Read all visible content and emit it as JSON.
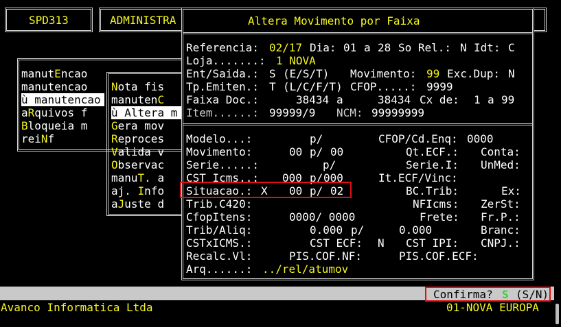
{
  "header": {
    "program": "SPD313",
    "module": "ADMINISTRA",
    "dialog_title": "Altera Movimento por Faixa"
  },
  "menu1": [
    {
      "prefix": "",
      "pre": "manut",
      "hot": "E",
      "post": "ncao"
    },
    {
      "prefix": "",
      "pre": "",
      "hot": "",
      "post": "manutencao"
    },
    {
      "prefix": "ù ",
      "pre": "",
      "hot": "",
      "post": "manutencao"
    },
    {
      "prefix": "",
      "pre": "a",
      "hot": "R",
      "post": "quivos f"
    },
    {
      "prefix": "",
      "pre": "",
      "hot": "B",
      "post": "loqueia m"
    },
    {
      "prefix": "",
      "pre": "rei",
      "hot": "N",
      "post": "f"
    }
  ],
  "menu2": [
    {
      "prefix": "",
      "pre": "",
      "hot": "N",
      "post": "ota fis"
    },
    {
      "prefix": "",
      "pre": "manuten",
      "hot": "C",
      "post": ""
    },
    {
      "prefix": "ù ",
      "pre": "",
      "hot": "A",
      "post": "ltera m"
    },
    {
      "prefix": "",
      "pre": "",
      "hot": "G",
      "post": "era mov"
    },
    {
      "prefix": "",
      "pre": "",
      "hot": "R",
      "post": "eproces"
    },
    {
      "prefix": "",
      "pre": "",
      "hot": "V",
      "post": "alida v"
    },
    {
      "prefix": "",
      "pre": "",
      "hot": "O",
      "post": "bservac"
    },
    {
      "prefix": "",
      "pre": "manu",
      "hot": "T",
      "post": ". a"
    },
    {
      "prefix": "",
      "pre": "aj. ",
      "hot": "I",
      "post": "nfo"
    },
    {
      "prefix": "",
      "pre": "a",
      "hot": "J",
      "post": "uste d"
    }
  ],
  "form_top": {
    "referencia_label": "Referencia:",
    "referencia_value": "02/17",
    "dia_label": "Dia:",
    "dia_from": "01",
    "a1": "a",
    "dia_to": "28",
    "sorel_label": "So Rel.:",
    "sorel_value": "N",
    "idt_label": "Idt:",
    "idt_value": "C",
    "loja_label": "Loja.......:",
    "loja_value": "1 NOVA",
    "entsaida_label": "Ent/Saida.:",
    "entsaida_value": "S",
    "entsaida_hint": "(E/S/T)",
    "movimento_label": "Movimento:",
    "movimento_value": "99",
    "excdup_label": "Exc.Dup:",
    "excdup_value": "N",
    "tpemiten_label": "Tp.Emiten.:",
    "tpemiten_value": "T",
    "tpemiten_hint": "(L/C/F/T)",
    "cfop_label": "CFOP.....:",
    "cfop_value": "9999",
    "faixadoc_label": "Faixa Doc.:",
    "faixadoc_from": "38434",
    "a2": "a",
    "faixadoc_to": "38434",
    "cxde_label": "Cx de:",
    "cx_from": "1",
    "a3": "a",
    "cx_to": "99",
    "item_label": "Item......:",
    "item_value": "99999/9",
    "ncm_label": "NCM:",
    "ncm_value": "99999999"
  },
  "form_bottom": {
    "modelo_label": "Modelo...:",
    "modelo_sep": "p/",
    "cfopcdenq_label": "CFOP/Cd.Enq:",
    "cfopcdenq_value": "0000",
    "movimento_label": "Movimento:",
    "movimento_from": "00",
    "movimento_sep": "p/",
    "movimento_to": "00",
    "qtecf_label": "Qt.ECF.:",
    "conta_label": "Conta:",
    "serie_label": "Serie.....:",
    "serie_sep": "p/",
    "seriei_label": "Serie.I:",
    "unmed_label": "UnMed:",
    "csticms_label": "CST Icms..:",
    "csticms_from": "000",
    "csticms_sep": "p/",
    "csticms_to": "000",
    "itecfvinc_label": "It.ECF/Vinc:",
    "situacao_label": "Situacao.:",
    "situacao_flag": "X",
    "situacao_from": "00",
    "situacao_sep": "p/",
    "situacao_to": "02",
    "bctrib_label": "BC.Trib:",
    "ex_label": "Ex:",
    "tribc420_label": "Trib.C420:",
    "nficms_label": "NFIcms:",
    "zerst_label": "ZerSt:",
    "cfopitens_label": "CfopItens:",
    "cfopitens_value": "0000/ 0000",
    "frete_label": "Frete:",
    "frp_label": "Fr.P.:",
    "tribaliq_label": "Trib/Aliq:",
    "tribaliq_from": "0.000",
    "tribaliq_sep": "p/",
    "tribaliq_to": "0.000",
    "branc_label": "Branc:",
    "cstxicms_label": "CSTxICMS.:",
    "cstecf_label": "CST ECF:",
    "cstecf_value": "N",
    "cstipi_label": "CST IPI:",
    "cnpj_label": "CNPJ.:",
    "recalcvl_label": "Recalc.Vl:",
    "piscofnf_label": "PIS.COF.NF:",
    "piscofecf_label": "PIS.COF.ECF:",
    "arq_label": "Arq......:",
    "arq_value": "../rel/atumov"
  },
  "status": {
    "confirm_label": "Confirma?",
    "confirm_value": "S",
    "confirm_hint": "(S/N)",
    "company": "Avanco Informatica Ltda",
    "store": "01-NOVA EUROPA"
  },
  "colors": {
    "background": "#000000",
    "label": "#ffffff",
    "value": "#f5f51e",
    "highlight_border": "#e01010",
    "confirm_value": "#2bd82b"
  }
}
